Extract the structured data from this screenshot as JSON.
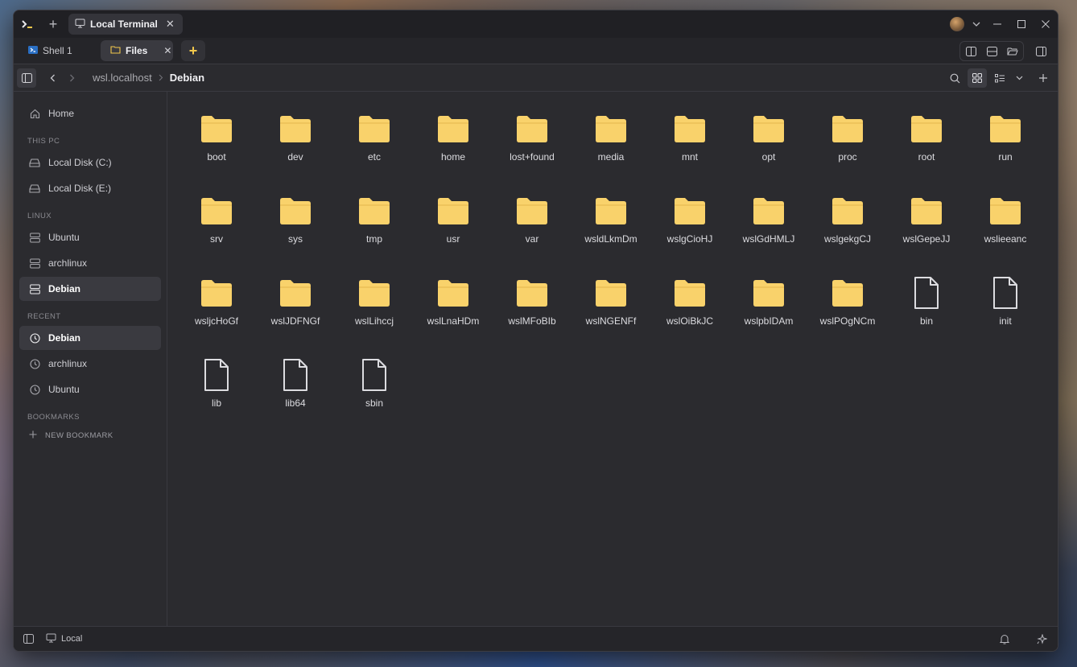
{
  "titlebar": {
    "app_icon": "terminal-prompt-icon",
    "new_tab_label": "+",
    "tab": {
      "label": "Local Terminal",
      "icon": "monitor-icon",
      "close": "✕"
    }
  },
  "tabstrip": {
    "tabs": [
      {
        "label": "Shell 1",
        "icon": "powershell-icon",
        "close": ""
      },
      {
        "label": "Files",
        "icon": "folder-icon",
        "close": "✕"
      }
    ],
    "add_label": "+"
  },
  "pathbar": {
    "crumbs": [
      "wsl.localhost",
      "Debian"
    ]
  },
  "sidebar": {
    "home": "Home",
    "sections": [
      {
        "title": "THIS PC",
        "items": [
          "Local Disk (C:)",
          "Local Disk (E:)"
        ]
      },
      {
        "title": "LINUX",
        "items": [
          "Ubuntu",
          "archlinux",
          "Debian"
        ]
      },
      {
        "title": "RECENT",
        "items": [
          "Debian",
          "archlinux",
          "Ubuntu"
        ]
      },
      {
        "title": "BOOKMARKS",
        "items": []
      }
    ],
    "new_bookmark": "NEW BOOKMARK"
  },
  "files": [
    {
      "name": "boot",
      "type": "folder"
    },
    {
      "name": "dev",
      "type": "folder"
    },
    {
      "name": "etc",
      "type": "folder"
    },
    {
      "name": "home",
      "type": "folder"
    },
    {
      "name": "lost+found",
      "type": "folder"
    },
    {
      "name": "media",
      "type": "folder"
    },
    {
      "name": "mnt",
      "type": "folder"
    },
    {
      "name": "opt",
      "type": "folder"
    },
    {
      "name": "proc",
      "type": "folder"
    },
    {
      "name": "root",
      "type": "folder"
    },
    {
      "name": "run",
      "type": "folder"
    },
    {
      "name": "srv",
      "type": "folder"
    },
    {
      "name": "sys",
      "type": "folder"
    },
    {
      "name": "tmp",
      "type": "folder"
    },
    {
      "name": "usr",
      "type": "folder"
    },
    {
      "name": "var",
      "type": "folder"
    },
    {
      "name": "wsldLkmDm",
      "type": "folder"
    },
    {
      "name": "wslgCioHJ",
      "type": "folder"
    },
    {
      "name": "wslGdHMLJ",
      "type": "folder"
    },
    {
      "name": "wslgekgCJ",
      "type": "folder"
    },
    {
      "name": "wslGepeJJ",
      "type": "folder"
    },
    {
      "name": "wslieeanc",
      "type": "folder"
    },
    {
      "name": "wsljcHoGf",
      "type": "folder"
    },
    {
      "name": "wslJDFNGf",
      "type": "folder"
    },
    {
      "name": "wslLihccj",
      "type": "folder"
    },
    {
      "name": "wslLnaHDm",
      "type": "folder"
    },
    {
      "name": "wslMFoBIb",
      "type": "folder"
    },
    {
      "name": "wslNGENFf",
      "type": "folder"
    },
    {
      "name": "wslOiBkJC",
      "type": "folder"
    },
    {
      "name": "wslpbIDAm",
      "type": "folder"
    },
    {
      "name": "wslPOgNCm",
      "type": "folder"
    },
    {
      "name": "bin",
      "type": "file"
    },
    {
      "name": "init",
      "type": "file"
    },
    {
      "name": "lib",
      "type": "file"
    },
    {
      "name": "lib64",
      "type": "file"
    },
    {
      "name": "sbin",
      "type": "file"
    }
  ],
  "statusbar": {
    "connection": "Local"
  },
  "colors": {
    "folder": "#f9d26b",
    "background": "#2b2b2f",
    "accent": "#f3c84c"
  }
}
